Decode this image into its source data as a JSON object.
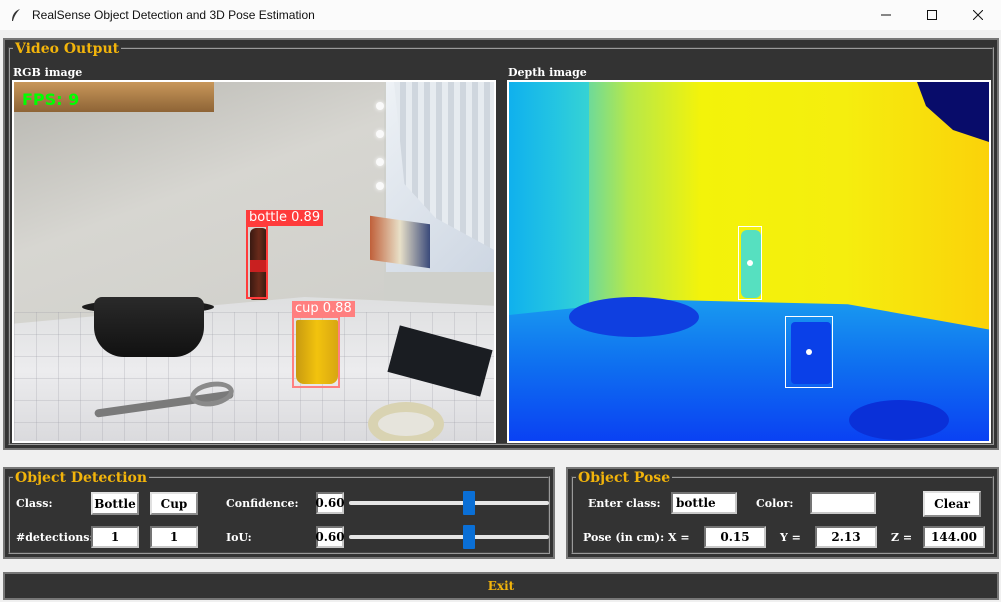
{
  "window": {
    "title": "RealSense Object Detection and 3D Pose Estimation",
    "controls": [
      "minimize-icon",
      "maximize-icon",
      "close-icon"
    ]
  },
  "video_output": {
    "legend": "Video Output",
    "rgb_label": "RGB image",
    "depth_label": "Depth image",
    "fps_overlay": "FPS: 9",
    "detections": [
      {
        "label": "bottle 0.89",
        "color": "#ff3b3b"
      },
      {
        "label": "cup 0.88",
        "color": "#ff7f7f"
      }
    ]
  },
  "object_detection": {
    "legend": "Object Detection",
    "class_label": "Class:",
    "class_buttons": [
      "Bottle",
      "Cup"
    ],
    "detections_label": "#detections:",
    "detection_counts": [
      "1",
      "1"
    ],
    "confidence_label": "Confidence:",
    "confidence_value": "0.60",
    "iou_label": "IoU:",
    "iou_value": "0.60",
    "confidence_slider_level": 0.6,
    "iou_slider_level": 0.6
  },
  "object_pose": {
    "legend": "Object Pose",
    "enter_class_label": "Enter class:",
    "enter_class_value": "bottle",
    "color_label": "Color:",
    "color_value": "",
    "clear_button": "Clear",
    "pose_label": "Pose (in cm):",
    "x_label": "X =",
    "x_value": "0.15",
    "y_label": "Y =",
    "y_value": "2.13",
    "z_label": "Z =",
    "z_value": "144.00"
  },
  "exit_button": "Exit",
  "colors": {
    "panel_bg": "#333333",
    "legend": "#f2b40b",
    "slider_thumb": "#0a6fd6",
    "fps_text": "#00ff00"
  }
}
